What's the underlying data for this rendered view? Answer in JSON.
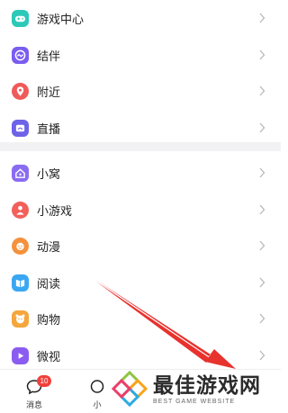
{
  "menu": {
    "group1": [
      {
        "label": "游戏中心",
        "icon": "gamepad-icon",
        "color": "#2dc9b8"
      },
      {
        "label": "结伴",
        "icon": "companion-icon",
        "color": "#7a5cf0"
      },
      {
        "label": "附近",
        "icon": "location-pin-icon",
        "color": "#f05a5a"
      },
      {
        "label": "直播",
        "icon": "live-icon",
        "color": "#6c63e8"
      }
    ],
    "group2": [
      {
        "label": "小窝",
        "icon": "home-icon",
        "color": "#8a6cf2"
      },
      {
        "label": "小游戏",
        "icon": "mini-game-icon",
        "color": "#f2605a"
      },
      {
        "label": "动漫",
        "icon": "anime-icon",
        "color": "#f5913c"
      },
      {
        "label": "阅读",
        "icon": "reading-icon",
        "color": "#3aa7f2"
      },
      {
        "label": "购物",
        "icon": "shopping-icon",
        "color": "#f5a63c"
      },
      {
        "label": "微视",
        "icon": "weishi-icon",
        "color": "#8b5cf0"
      }
    ]
  },
  "tabbar": {
    "messages": {
      "label": "消息",
      "badge": "10"
    },
    "second": {
      "label": "小"
    }
  },
  "annotation": {
    "arrow_color": "#e8322e"
  },
  "watermark": {
    "title": "最佳游戏网",
    "subtitle": "BEST GAME WEBSITE"
  }
}
